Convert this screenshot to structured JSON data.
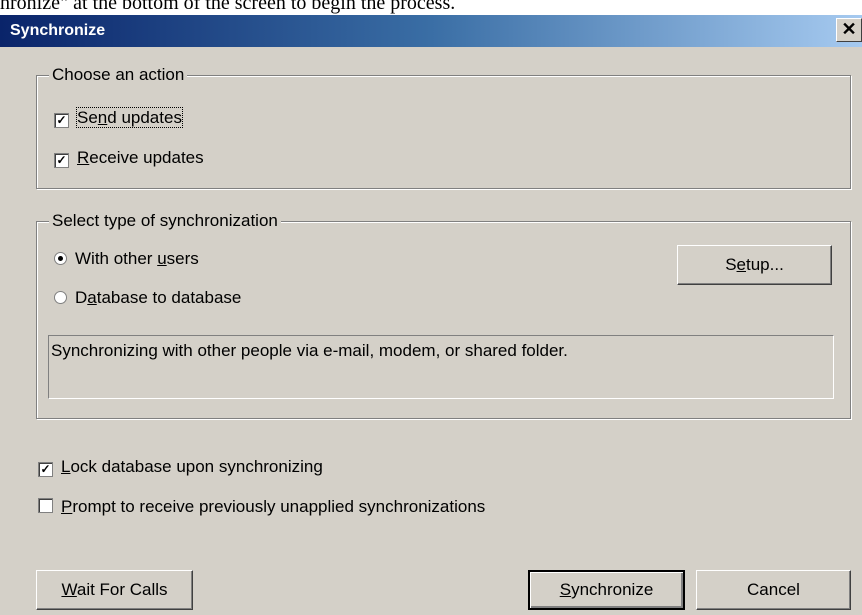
{
  "background": {
    "text": "hronize\" at the bottom of the screen to begin the process."
  },
  "window": {
    "title": "Synchronize",
    "close_glyph": "✕"
  },
  "action_group": {
    "legend": "Choose an action",
    "items": [
      {
        "label": "Send updates",
        "checked": true
      },
      {
        "label": "Receive updates",
        "checked": true
      }
    ]
  },
  "sync_type_group": {
    "legend": "Select type of synchronization",
    "options": [
      {
        "label": "With other users",
        "selected": true
      },
      {
        "label": "Database to database",
        "selected": false
      }
    ],
    "setup_label": "Setup...",
    "description": "Synchronizing with other people via e-mail, modem, or shared folder."
  },
  "options": [
    {
      "label": "Lock database upon synchronizing",
      "checked": true
    },
    {
      "label": "Prompt to receive previously unapplied synchronizations",
      "checked": false
    }
  ],
  "footer": {
    "wait_label": "Wait For Calls",
    "synchronize_label": "Synchronize",
    "cancel_label": "Cancel"
  },
  "colors": {
    "titlebar_start": "#0a246a",
    "titlebar_end": "#a6caf0",
    "face": "#d4d0c8"
  }
}
